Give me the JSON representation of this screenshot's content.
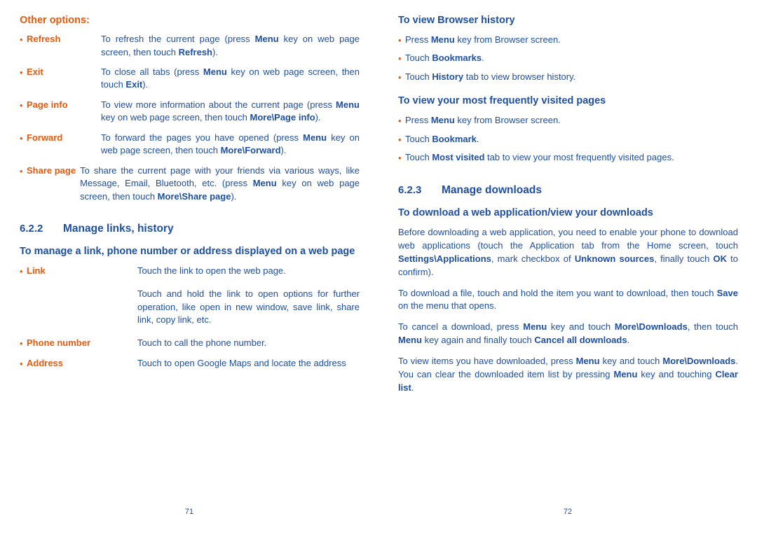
{
  "left_page": {
    "number": "71",
    "other_options": {
      "heading": "Other options:",
      "items": [
        {
          "term": "Refresh",
          "desc_html": "To refresh the current page (press <b>Menu</b> key on web page screen, then touch <b>Refresh</b>)."
        },
        {
          "term": "Exit",
          "desc_html": "To close all tabs (press <b>Menu</b> key on web page screen, then touch <b>Exit</b>)."
        },
        {
          "term": "Page info",
          "desc_html": "To view more information about the current page (press <b>Menu</b> key on web page screen, then touch <b>More\\Page info</b>)."
        },
        {
          "term": "Forward",
          "desc_html": "To forward the pages you have opened (press <b>Menu</b> key on web page screen, then touch <b>More\\Forward</b>)."
        },
        {
          "term": "Share page",
          "desc_html": "To share the current page with your friends via various ways, like Message, Email, Bluetooth, etc. (press <b>Menu</b> key on web page screen, then touch <b>More\\Share page</b>)."
        }
      ]
    },
    "section": {
      "number": "6.2.2",
      "title": "Manage links, history"
    },
    "manage_link": {
      "heading": "To manage a link, phone number or address displayed on a web page",
      "items": [
        {
          "term": "Link",
          "desc_html": "Touch the link to open the web page."
        },
        {
          "term": "",
          "desc_html": "Touch and hold the link to open options for further operation, like open in new window, save link, share link, copy link, etc."
        },
        {
          "term": "Phone number",
          "desc_html": "Touch to call the phone number."
        },
        {
          "term": "Address",
          "desc_html": "Touch to open Google Maps and locate the address"
        }
      ]
    }
  },
  "right_page": {
    "number": "72",
    "browser_history": {
      "heading": "To view Browser history",
      "items": [
        "Press <b>Menu</b> key from Browser screen.",
        "Touch <b>Bookmarks</b>.",
        "Touch <b>History</b> tab to view browser history."
      ]
    },
    "frequent_pages": {
      "heading": "To view your most frequently visited pages",
      "items": [
        "Press <b>Menu</b> key from Browser screen.",
        "Touch <b>Bookmark</b>.",
        "Touch <b>Most visited</b> tab to view your most frequently visited pages."
      ]
    },
    "section": {
      "number": "6.2.3",
      "title": "Manage downloads"
    },
    "downloads": {
      "heading": "To download a web application/view your downloads",
      "paragraphs": [
        "Before downloading a web application, you need to enable your phone to download web applications (touch the Application tab from the Home screen, touch <b>Settings\\Applications</b>, mark checkbox of <b>Unknown sources</b>, finally touch <b>OK</b> to confirm).",
        "To download a file, touch and hold the item you want to download, then touch <b>Save</b> on the menu that opens.",
        "To cancel a download, press <b>Menu</b> key and touch <b>More\\Downloads</b>, then touch <b>Menu</b> key again and finally touch <b>Cancel all downloads</b>.",
        "To view items you have downloaded, press <b>Menu</b> key and touch <b>More\\Downloads</b>. You can clear the downloaded item list by pressing <b>Menu</b> key and touching <b>Clear list</b>."
      ]
    }
  },
  "colors": {
    "blue": "#1e4fa0",
    "orange": "#e8590c"
  }
}
